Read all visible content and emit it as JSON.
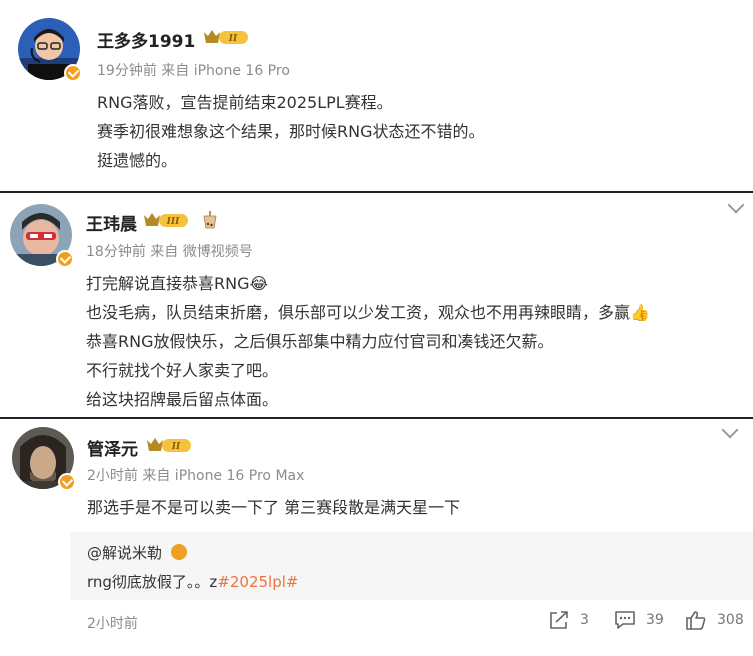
{
  "posts": [
    {
      "name": "王多多1991",
      "level": "II",
      "meta": "19分钟前 来自 iPhone 16 Pro",
      "lines": [
        "RNG落败，宣告提前结束2025LPL赛程。",
        "赛季初很难想象这个结果，那时候RNG状态还不错的。",
        "挺遗憾的。"
      ]
    },
    {
      "name": "王玮晨",
      "level": "III",
      "meta": "18分钟前 来自 微博视频号",
      "lines": [
        "打完解说直接恭喜RNG😂",
        "也没毛病，队员结束折磨，俱乐部可以少发工资，观众也不用再辣眼睛，多赢👍",
        "恭喜RNG放假快乐，之后俱乐部集中精力应付官司和凑钱还欠薪。",
        "不行就找个好人家卖了吧。",
        "给这块招牌最后留点体面。"
      ]
    },
    {
      "name": "管泽元",
      "level": "II",
      "meta": "2小时前 来自 iPhone 16 Pro Max",
      "lines": [
        "那选手是不是可以卖一下了 第三赛段散是满天星一下"
      ],
      "quote": {
        "author": "@解说米勒",
        "text": "rng彻底放假了。。z",
        "hashtag": "#2025lpl#"
      },
      "time": "2小时前",
      "repost_count": "3",
      "comment_count": "39",
      "like_count": "308"
    }
  ]
}
